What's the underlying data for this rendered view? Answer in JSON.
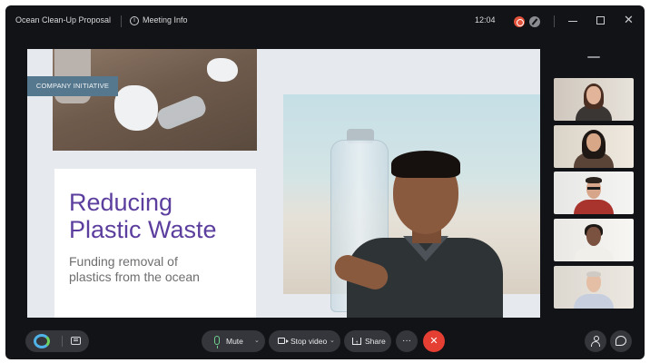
{
  "titlebar": {
    "meeting_title": "Ocean Clean-Up Proposal",
    "meeting_info_label": "Meeting Info",
    "clock": "12:04"
  },
  "slide": {
    "badge": "COMPANY INITIATIVE",
    "title_line1": "Reducing",
    "title_line2": "Plastic Waste",
    "subtitle_line1": "Funding removal of",
    "subtitle_line2": "plastics from the ocean"
  },
  "participants_count_shown": 5,
  "controls": {
    "mute_label": "Mute",
    "stop_video_label": "Stop video",
    "share_label": "Share",
    "more_label": "···",
    "end_label": "✕"
  },
  "colors": {
    "accent_purple": "#5b3e9d",
    "end_call_red": "#e53e33",
    "record_red": "#e3523a",
    "mic_green": "#6fd18f",
    "badge_blue": "#56788e"
  },
  "icons": [
    "info-icon",
    "record-icon",
    "annotate-icon",
    "minimize-icon",
    "maximize-icon",
    "close-icon",
    "app-logo-icon",
    "chat-icon",
    "mic-icon",
    "chevron-down-icon",
    "camera-icon",
    "share-icon",
    "more-icon",
    "end-call-icon",
    "participants-icon",
    "messages-icon"
  ]
}
